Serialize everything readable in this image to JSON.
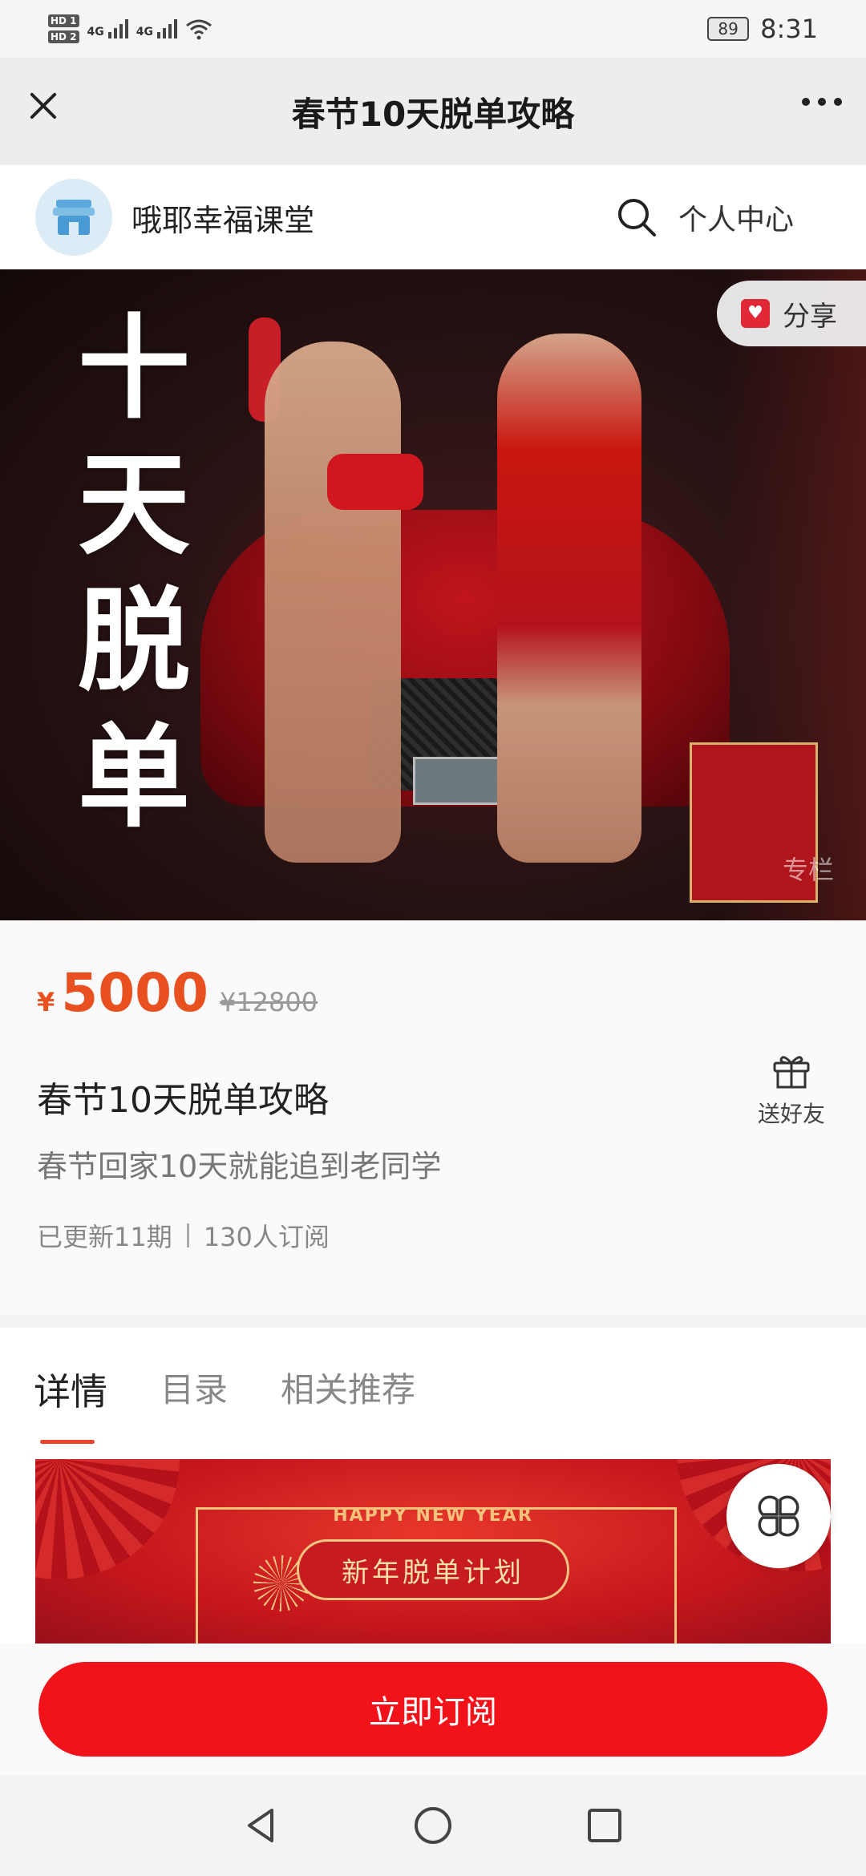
{
  "status_bar": {
    "hd1": "HD 1",
    "hd2": "HD 2",
    "net1": "4G",
    "net2": "4G",
    "battery": "89",
    "time": "8:31"
  },
  "title_bar": {
    "title": "春节10天脱单攻略",
    "close_icon": "close-icon",
    "more_icon": "more-icon"
  },
  "shop": {
    "name": "哦耶幸福课堂",
    "search_icon": "search-icon",
    "personal_center": "个人中心"
  },
  "hero": {
    "title_chars": [
      "十",
      "天",
      "脱",
      "单"
    ],
    "share_label": "分享",
    "column_tag": "专栏"
  },
  "product": {
    "currency": "¥",
    "price": "5000",
    "original_price": "¥12800",
    "title": "春节10天脱单攻略",
    "gift_label": "送好友",
    "subtitle": "春节回家10天就能追到老同学",
    "updates": "已更新11期",
    "subscribers": "130人订阅"
  },
  "tabs": [
    {
      "label": "详情",
      "active": true
    },
    {
      "label": "目录",
      "active": false
    },
    {
      "label": "相关推荐",
      "active": false
    }
  ],
  "banner": {
    "english": "HAPPY NEW YEAR",
    "slogan": "新年脱单计划"
  },
  "subscribe": {
    "label": "立即订阅"
  },
  "colors": {
    "accent": "#f2131a",
    "price": "#e8501f",
    "tab_indicator": "#e8442a"
  }
}
